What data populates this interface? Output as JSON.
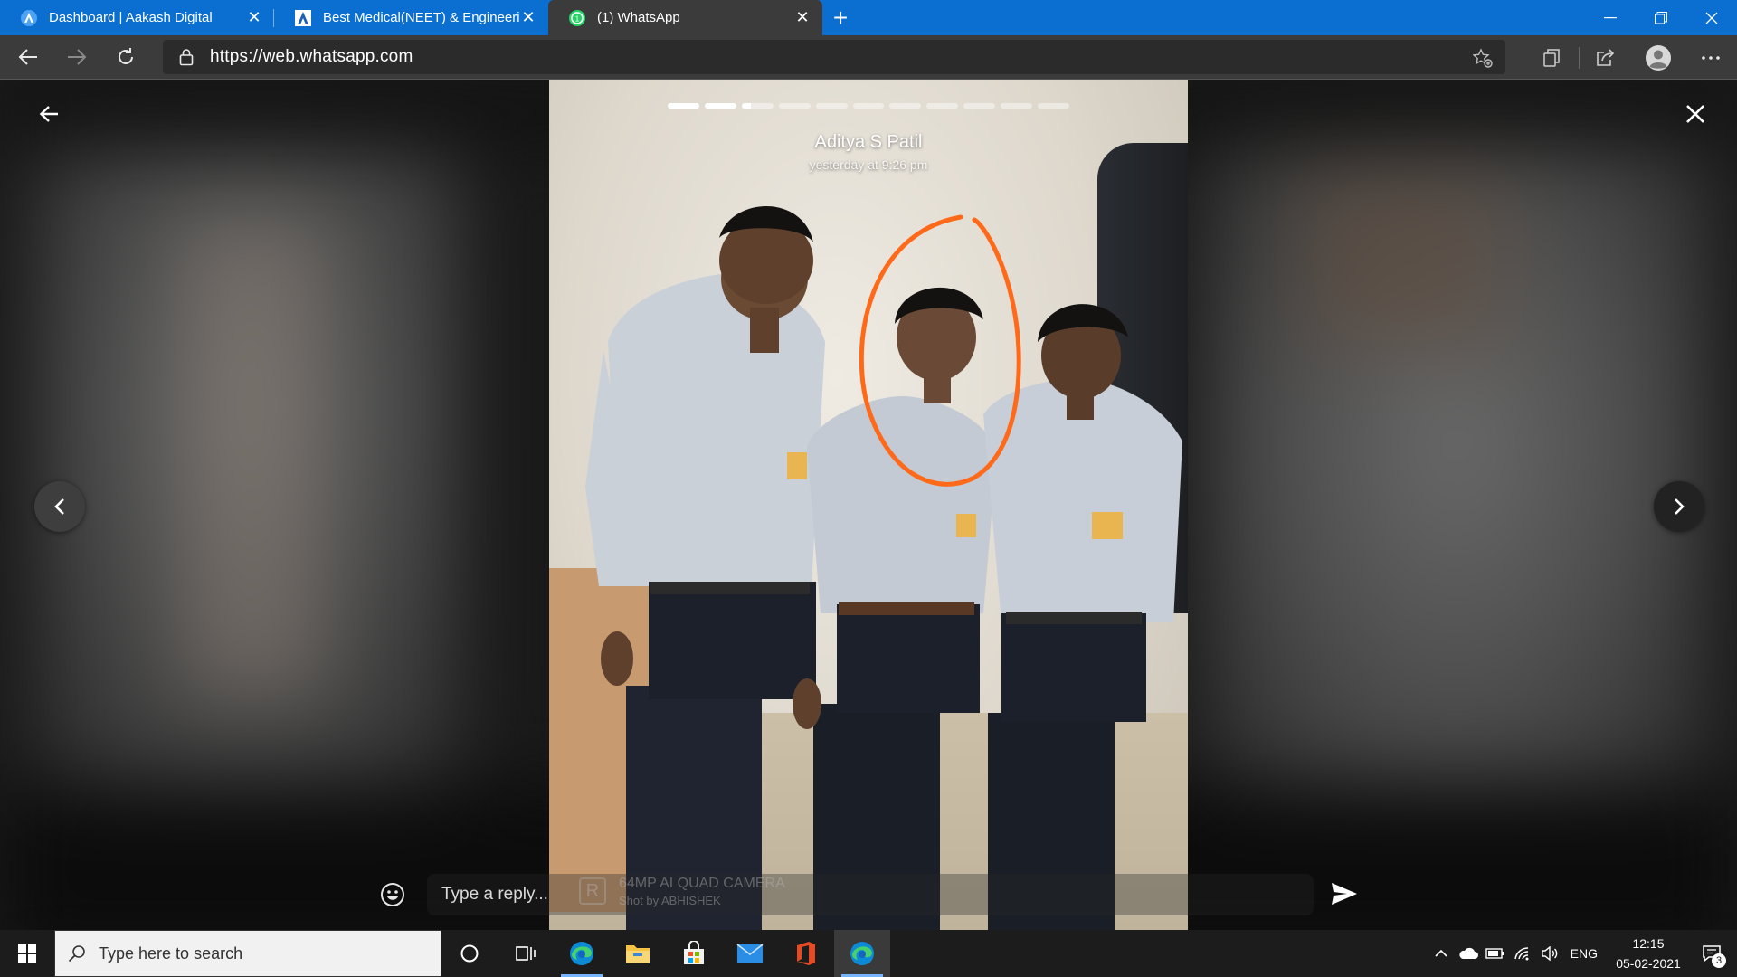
{
  "browser": {
    "tabs": [
      {
        "title": "Dashboard | Aakash Digital"
      },
      {
        "title": "Best Medical(NEET) & Engineering"
      },
      {
        "title": "(1) WhatsApp"
      }
    ],
    "url": "https://web.whatsapp.com"
  },
  "status": {
    "user_name": "Aditya S Patil",
    "timestamp": "yesterday at 9:26 pm",
    "segments": [
      1,
      1,
      0.3,
      0,
      0,
      0,
      0,
      0,
      0,
      0,
      0
    ],
    "watermark_line1": "64MP AI QUAD CAMERA",
    "watermark_line2": "Shot by ABHISHEK",
    "reply_placeholder": "Type a reply..."
  },
  "taskbar": {
    "search_placeholder": "Type here to search",
    "language": "ENG",
    "time": "12:15",
    "date": "05-02-2021",
    "notification_count": "3"
  },
  "colors": {
    "accent_titlebar": "#0a6fd0",
    "whatsapp_green": "#25d366",
    "annotation_circle": "#ff6a1a"
  }
}
